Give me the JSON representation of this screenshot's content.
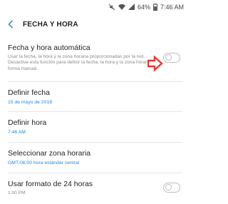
{
  "status_bar": {
    "battery": "64%",
    "time": "7:46 AM"
  },
  "header": {
    "title": "FECHA Y HORA"
  },
  "settings": [
    {
      "title": "Fecha y hora automática",
      "description": "Usar la fecha, la hora y la zona horaria proporcionadas por la red. Desactive esta función para definir la fecha, la hora y la zona horaria de forma manual.",
      "toggle": "off"
    },
    {
      "title": "Definir fecha",
      "value": "15 de mayo de 2018"
    },
    {
      "title": "Definir hora",
      "value": "7:46 AM"
    },
    {
      "title": "Seleccionar zona horaria",
      "value": "GMT-06:00 hora estándar central"
    },
    {
      "title": "Usar formato de 24 horas",
      "value": "1:00 PM",
      "toggle": "off"
    }
  ],
  "colors": {
    "accent": "#1e88e5",
    "annotation_arrow": "#e53935"
  }
}
